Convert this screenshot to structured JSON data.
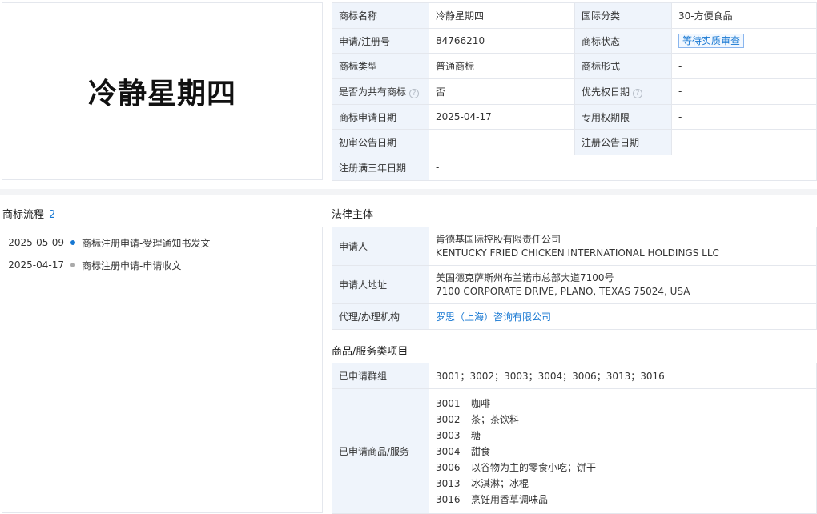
{
  "trademark_image_text": "冷静星期四",
  "info": {
    "name_label": "商标名称",
    "name_value": "冷静星期四",
    "class_label": "国际分类",
    "class_value": "30-方便食品",
    "reg_no_label": "申请/注册号",
    "reg_no_value": "84766210",
    "status_label": "商标状态",
    "status_value": "等待实质审查",
    "type_label": "商标类型",
    "type_value": "普通商标",
    "form_label": "商标形式",
    "form_value": "-",
    "shared_label": "是否为共有商标",
    "shared_value": "否",
    "priority_label": "优先权日期",
    "priority_value": "-",
    "apply_date_label": "商标申请日期",
    "apply_date_value": "2025-04-17",
    "exclusive_label": "专用权期限",
    "exclusive_value": "-",
    "prelim_label": "初审公告日期",
    "prelim_value": "-",
    "reg_announce_label": "注册公告日期",
    "reg_announce_value": "-",
    "three_year_label": "注册满三年日期",
    "three_year_value": "-"
  },
  "flow": {
    "title": "商标流程",
    "count": "2",
    "events": [
      {
        "date": "2025-05-09",
        "text": "商标注册申请-受理通知书发文"
      },
      {
        "date": "2025-04-17",
        "text": "商标注册申请-申请收文"
      }
    ]
  },
  "legal": {
    "title": "法律主体",
    "applicant_label": "申请人",
    "applicant_cn": "肯德基国际控股有限责任公司",
    "applicant_en": "KENTUCKY FRIED CHICKEN INTERNATIONAL HOLDINGS LLC",
    "address_label": "申请人地址",
    "address_cn": "美国德克萨斯州布兰诺市总部大道7100号",
    "address_en": "7100 CORPORATE DRIVE, PLANO, TEXAS 75024, USA",
    "agent_label": "代理/办理机构",
    "agent_value": "罗思（上海）咨询有限公司"
  },
  "goods": {
    "title": "商品/服务类项目",
    "groups_label": "已申请群组",
    "groups_value": "3001；3002；3003；3004；3006；3013；3016",
    "items_label": "已申请商品/服务",
    "items": [
      {
        "code": "3001",
        "name": "咖啡"
      },
      {
        "code": "3002",
        "name": "茶；茶饮料"
      },
      {
        "code": "3003",
        "name": "糖"
      },
      {
        "code": "3004",
        "name": "甜食"
      },
      {
        "code": "3006",
        "name": "以谷物为主的零食小吃；饼干"
      },
      {
        "code": "3013",
        "name": "冰淇淋；冰棍"
      },
      {
        "code": "3016",
        "name": "烹饪用香草调味品"
      }
    ]
  },
  "colors": {
    "accent": "#1677d2",
    "label_bg": "#eff4fb",
    "border": "#e4e7ed"
  },
  "icons": {
    "help": "question-circle-icon",
    "timeline_dot": "dot-icon"
  }
}
